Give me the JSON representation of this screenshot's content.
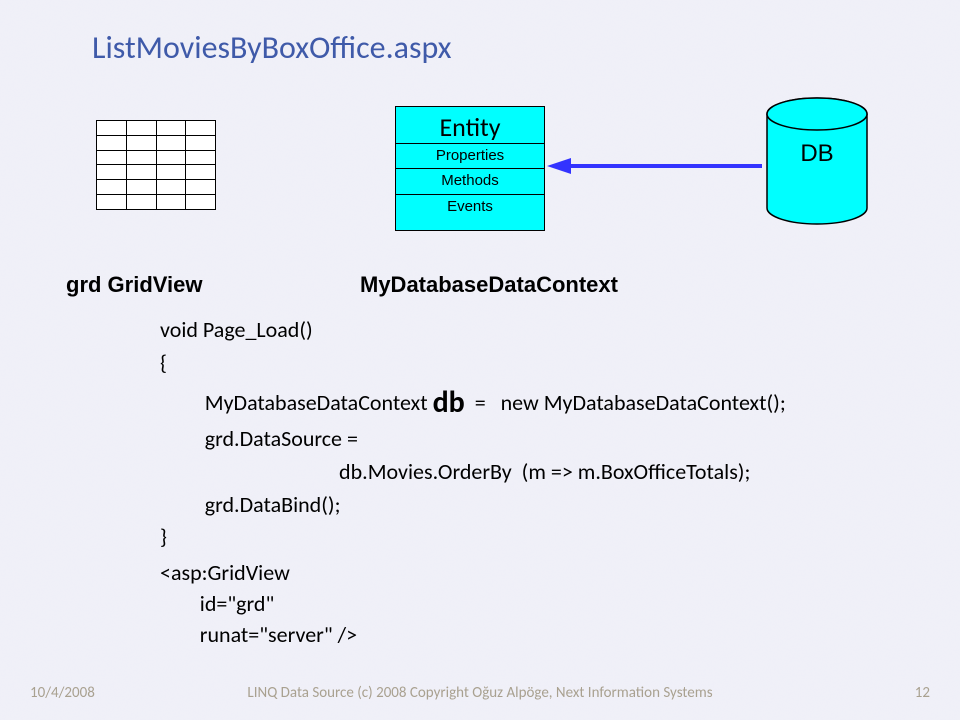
{
  "title": "ListMoviesByBoxOffice.aspx",
  "entity": {
    "title": "Entity",
    "properties": "Properties",
    "methods": "Methods",
    "events": "Events"
  },
  "db_label": "DB",
  "grd_label": "grd   GridView",
  "ctx_label": "MyDatabaseDataContext",
  "code": {
    "l1": "void Page_Load()",
    "l2": "{",
    "l3a": "         MyDatabaseDataContext ",
    "l3_db": "db",
    "l3b": "  =   new MyDatabaseDataContext();",
    "l4": "         grd.DataSource =",
    "l5": "                                    db.Movies.OrderBy  (m => m.BoxOfficeTotals);",
    "l6": "         grd.DataBind();",
    "l7": "}"
  },
  "gridview_markup": {
    "l1": "<asp:GridView",
    "l2": "        id=\"grd\"",
    "l3": "        runat=\"server\" />"
  },
  "footer": {
    "date": "10/4/2008",
    "copyright": "LINQ Data Source (c) 2008 Copyright Oğuz Alpöge, Next Information Systems",
    "page": "12"
  },
  "colors": {
    "accent_cyan": "#00ffff",
    "title_blue": "#3f5aa9",
    "arrow_blue": "#3333ff"
  }
}
